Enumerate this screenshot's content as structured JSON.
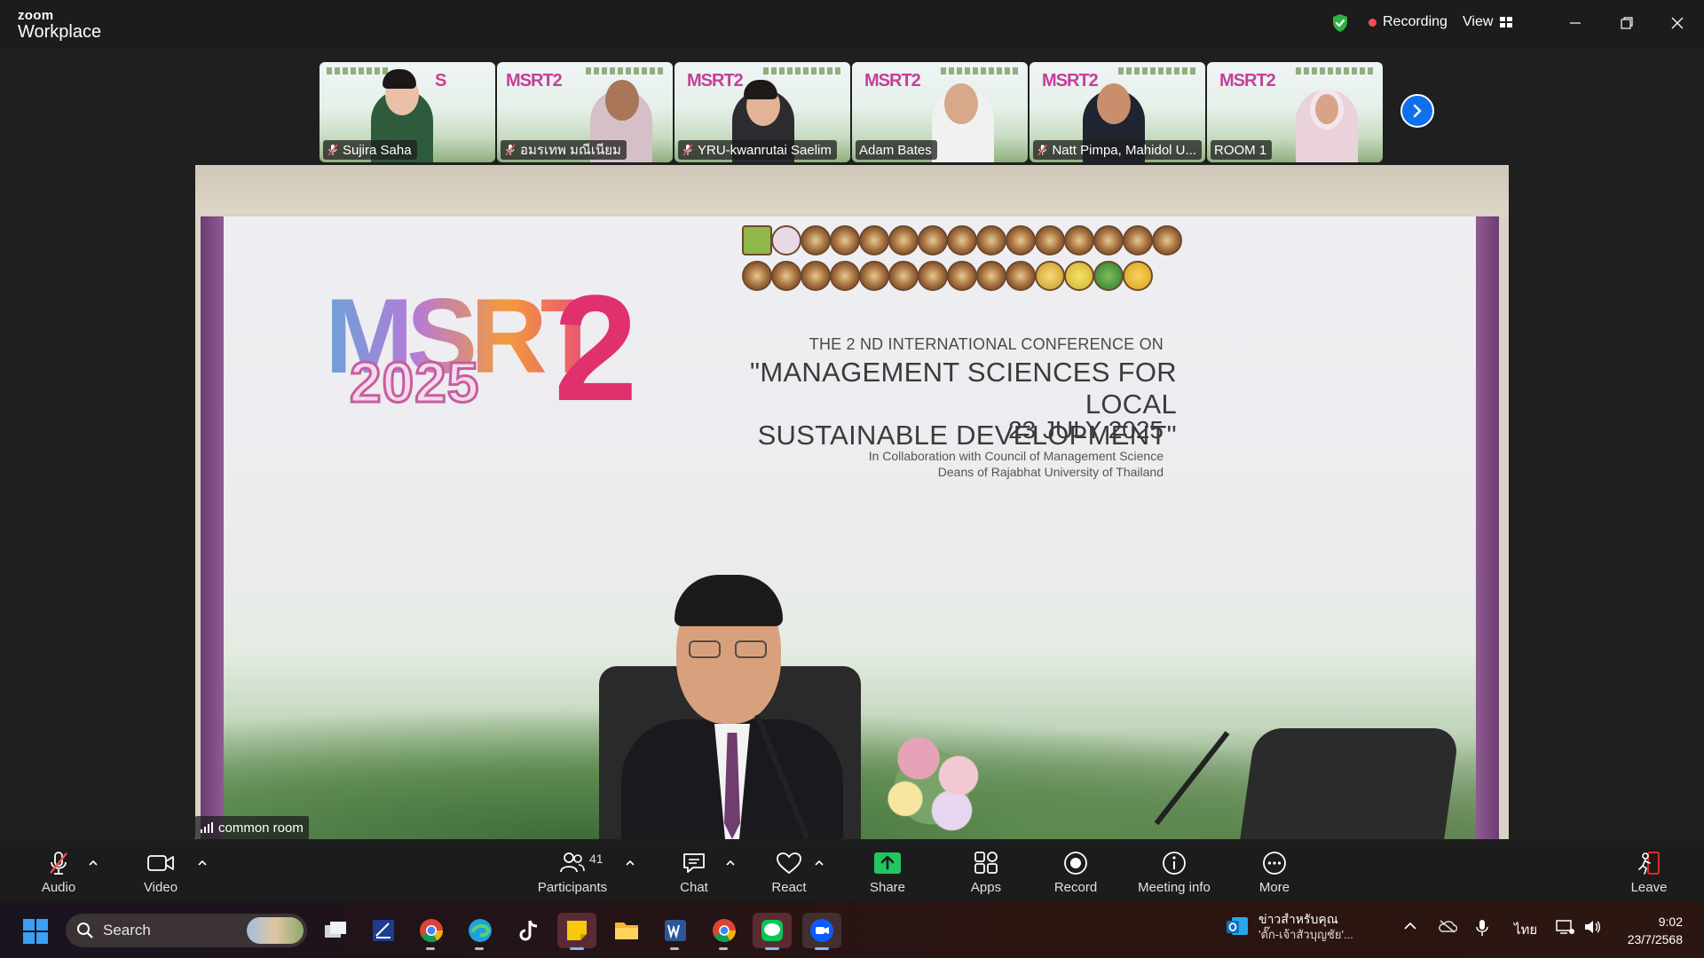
{
  "app": {
    "logo_line1": "zoom",
    "logo_line2": "Workplace",
    "recording_label": "Recording",
    "view_label": "View"
  },
  "participants": [
    {
      "name": "Sujira Saha",
      "muted": true
    },
    {
      "name": "อมรเทพ มณีเนียม",
      "muted": true
    },
    {
      "name": "YRU-kwanrutai Saelim",
      "muted": true
    },
    {
      "name": "Adam Bates",
      "muted": false
    },
    {
      "name": "Natt Pimpa, Mahidol U...",
      "muted": true
    },
    {
      "name": "ROOM 1",
      "muted": false
    }
  ],
  "main_video": {
    "logo_text": "MSRT",
    "logo_number": "2",
    "logo_year": "2025",
    "conference_line1": "THE 2 ND INTERNATIONAL CONFERENCE ON",
    "conference_title_line1": "\"MANAGEMENT SCIENCES FOR LOCAL",
    "conference_title_line2": "SUSTAINABLE DEVELOPMENT\"",
    "conference_date": "23 JULY 2025",
    "collab_line1": "In Collaboration with Council of Management Science",
    "collab_line2": "Deans of Rajabhat University of Thailand",
    "room_label": "common room"
  },
  "toolbar": {
    "audio": "Audio",
    "video": "Video",
    "participants": "Participants",
    "participants_count": "41",
    "chat": "Chat",
    "react": "React",
    "share": "Share",
    "apps": "Apps",
    "record": "Record",
    "meeting_info": "Meeting info",
    "more": "More",
    "leave": "Leave"
  },
  "taskbar": {
    "search_placeholder": "Search",
    "news_title": "ข่าวสำหรับคุณ",
    "news_subtitle": "'ตั๊ก-เจ้าสัวบุญชัย'...",
    "language": "ไทย",
    "time": "9:02",
    "date": "23/7/2568"
  },
  "colors": {
    "accent": "#0e71eb",
    "share_green": "#22c55e",
    "recording_red": "#ff4d4f",
    "shield_green": "#2fb344",
    "leave_red": "#e02828"
  }
}
